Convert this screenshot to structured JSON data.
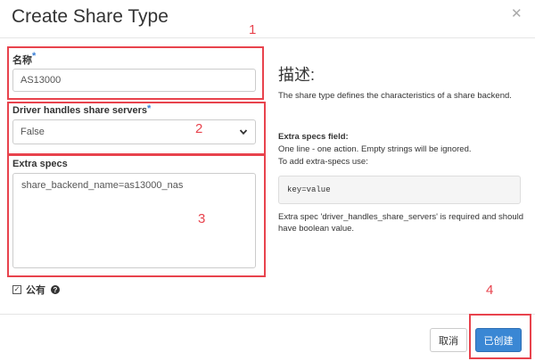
{
  "modal": {
    "title": "Create Share Type",
    "close_glyph": "✕"
  },
  "form": {
    "name_label": "名称",
    "required_marker": "*",
    "name_value": "AS13000",
    "driver_label": "Driver handles share servers",
    "driver_selected": "False",
    "extra_specs_label": "Extra specs",
    "extra_specs_value": "share_backend_name=as13000_nas",
    "public_checked_glyph": "✓",
    "public_label": "公有",
    "help_glyph": "?"
  },
  "description": {
    "heading": "描述:",
    "intro": "The share type defines the characteristics of a share backend.",
    "extra_specs_title": "Extra specs field:",
    "line1": "One line - one action. Empty strings will be ignored.",
    "line2": "To add extra-specs use:",
    "code": "key=value",
    "note": "Extra spec 'driver_handles_share_servers' is required and should have boolean value."
  },
  "footer": {
    "cancel_label": "取消",
    "create_label": "已创建"
  },
  "annotations": [
    "1",
    "2",
    "3",
    "4"
  ],
  "colors": {
    "annotation": "#e8434d",
    "primary": "#3a87d4",
    "required": "#3b7fd6"
  }
}
